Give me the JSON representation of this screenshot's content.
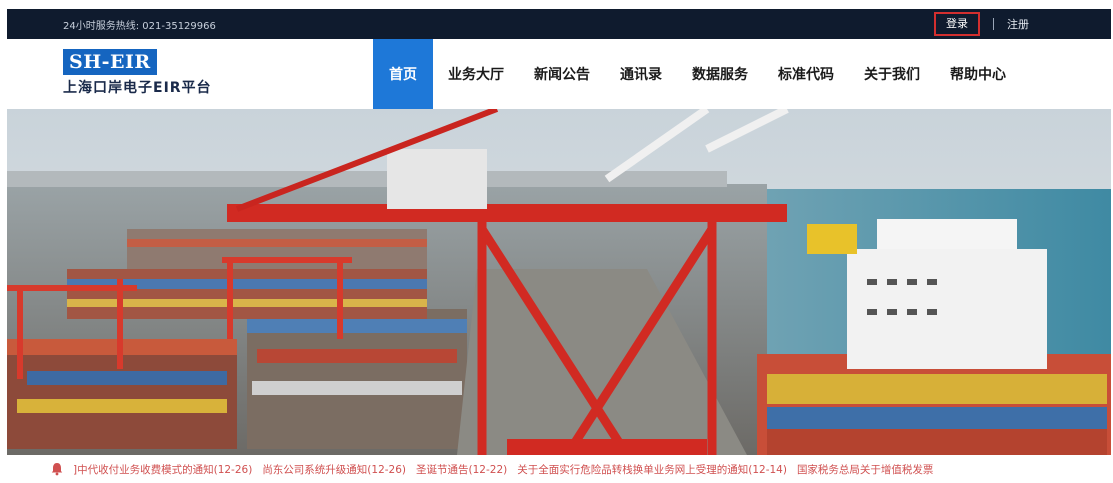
{
  "topbar": {
    "hotline": "24小时服务热线: 021-35129966",
    "login": "登录",
    "register": "注册"
  },
  "logo": {
    "mark": "SH-EIR",
    "name": "上海口岸电子EIR平台"
  },
  "nav": [
    "首页",
    "业务大厅",
    "新闻公告",
    "通讯录",
    "数据服务",
    "标准代码",
    "关于我们",
    "帮助中心"
  ],
  "ticker": {
    "items": [
      "]中代收付业务收费模式的通知(12-26)",
      "尚东公司系统升级通知(12-26)",
      "圣诞节通告(12-22)",
      "关于全面实行危险品转栈换单业务网上受理的通知(12-14)",
      "国家税务总局关于增值税发票"
    ]
  },
  "colors": {
    "topbar_bg": "#0f1b2e",
    "nav_active": "#1e78d8",
    "login_border": "#d32f2f",
    "ticker_text": "#d05050"
  },
  "icons": {
    "ticker": "bell-icon"
  }
}
